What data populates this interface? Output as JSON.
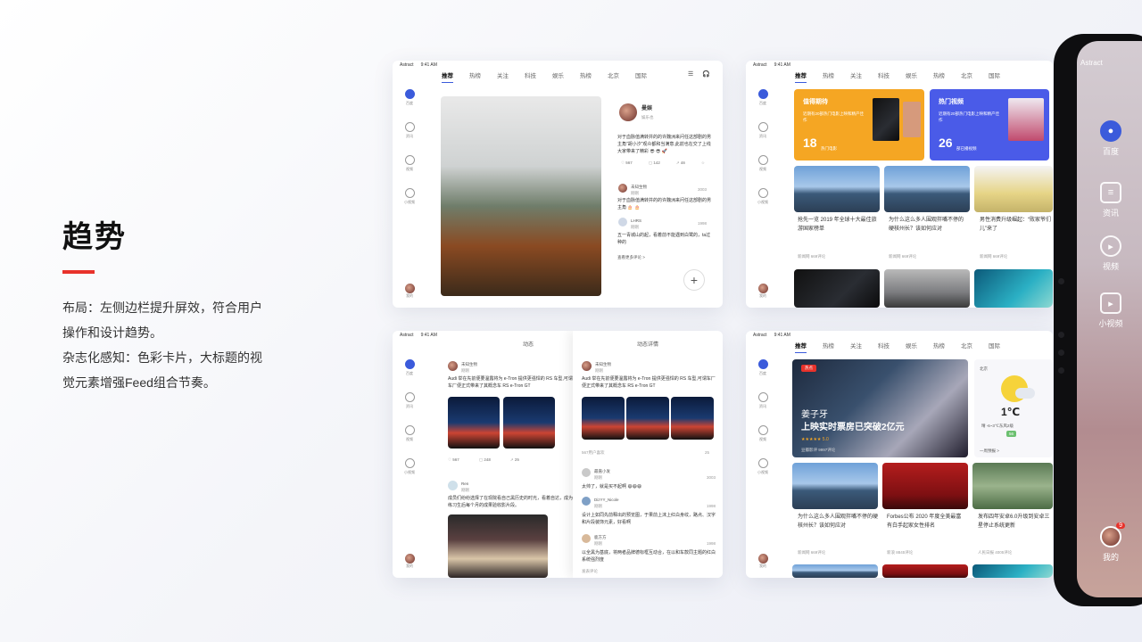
{
  "intro": {
    "title": "趋势",
    "line1": "布局：左侧边栏提升屏效，符合用户",
    "line2": "操作和设计趋势。",
    "line3": "杂志化感知：色彩卡片，大标题的视",
    "line4": "觉元素增强Feed组合节奏。"
  },
  "status": {
    "carrier": "Astract",
    "time": "9:41 AM",
    "battery": "100%"
  },
  "tabs": [
    "推荐",
    "热榜",
    "关注",
    "科技",
    "娱乐",
    "热榜",
    "北京",
    "国际"
  ],
  "sidebar": {
    "home": "百度",
    "news": "资讯",
    "video": "视频",
    "small_video": "小视频",
    "me": "我的"
  },
  "s1": {
    "user": "曼娱",
    "user_sub": "娱乐也",
    "post": "对于血脉值满转井的的许魏洲来问任这部剧的男主角“胡小汐”观众都和当满意,此前也在交了上线大家带来了精彩 😎 😎 🚀",
    "likes": "567",
    "comments": "142",
    "shares": "46",
    "c1_name": "未知生物",
    "c1_time": "刚刚",
    "c1_text": "对于血脉值满转井的的许魏洲来问任这部剧的男主角 🎂 🎂",
    "c1_count": "3003",
    "c2_name": "LHRS",
    "c2_time": "刚刚",
    "c2_text": "五一青城山的起，看着前不能遇到白鹭的，ta过种的",
    "c2_count": "1998",
    "more": "查看更多评论 >"
  },
  "s2": {
    "card1_title": "值得期待",
    "card1_desc": "近期有20部热门电影上映和精产佳作",
    "card1_num": "18",
    "card1_tag": "热门电影",
    "card1_time": "09:21",
    "card2_title": "热门视频",
    "card2_desc": "近期有20部热门电影上映和精产佳作",
    "card2_num": "26",
    "card2_tag": "部已播视频",
    "card2_time": "09:21",
    "n1": "抢先一览 2019 年全球十大最佳旅游国家榜单",
    "n1_src": "新闻网",
    "n1_cmt": "669评论",
    "n2": "为什么这么多人围观拌嘴不停的硬核州长？该如何应对",
    "n2_src": "新闻网",
    "n2_cmt": "669评论",
    "n3": "男性消费升级崛起：“败家爷们儿”来了",
    "n3_src": "新闻网",
    "n3_cmt": "669评论",
    "n3_time": "09:21"
  },
  "s3": {
    "left_title": "动态",
    "right_title": "动态详情",
    "a_name": "未知生物",
    "a_time": "刚刚",
    "a_text": "Audi 举在先前便要温露将为 e-Tron 提供更强悍的 RS 车型,可谓车厂便正式带来了其概念车 RS e-Tron GT",
    "a_likes": "567",
    "a_cmt": "248",
    "a_share": "25",
    "b_name": "Ren",
    "b_time": "刚刚",
    "b_text": "成员们纷纷选择了在现院看自己黑历史的时光，看着自达，成为练习生后每个月的成果验收影片段。",
    "d_name": "未知生物",
    "d_time": "刚刚",
    "d_text": "Audi 举在先前便要温露将为 e-Tron 提供更强悍的 RS 车型,可谓车厂便正式带来了其概念车 RS e-Tron GT",
    "d_likes": "567用户喜欢",
    "d_share": "25",
    "r1_name": "最嘉小发",
    "r1_time": "刚刚",
    "r1_text": "太帅了，就是买不起啊 😄😄😄",
    "r1_count": "3003",
    "r2_name": "DizYY_Nicole",
    "r2_time": "刚刚",
    "r2_text": "设计上如同先前释出的预览图，于果前上沫上红白身纹，路点、汉字和片段装饰元素，好看啊",
    "r2_count": "1998",
    "r3_name": "鹿方方",
    "r3_time": "刚刚",
    "r3_text": "以全黑为基底，将两者品牌德标框互动合，在以和车款同主题的红白系统强烈度",
    "r3_count": "1998",
    "more": "发表评论"
  },
  "s4": {
    "hot_tag": "热点",
    "hero_t1": "姜子牙",
    "hero_t2": "上映实时票房已突破2亿元",
    "hero_stars": "★★★★★ 5.0",
    "hero_src": "豆瓣影评",
    "hero_cmt": "9997评论",
    "weather_city": "北京",
    "weather_temp": "1℃",
    "weather_desc": "晴 -6~3℃东风2级",
    "weather_aqi": "56",
    "weather_more": "一周预报 >",
    "n1": "为什么这么多人围观拌嘴不停的硬核州长？该如何应对",
    "n1_src": "新闻网",
    "n1_cmt": "669评论",
    "n2": "Forbes公布 2020 年度全美最富有白手起家女性排名",
    "n2_src": "新浪",
    "n2_cmt": "8845评论",
    "n3": "发布四年安卓6.0升级到安卓三星停止系统更新",
    "n3_src": "人民日报",
    "n3_cmt": "4005评论"
  },
  "device": {
    "carrier": "Astract",
    "home": "百度",
    "news": "资讯",
    "video": "视频",
    "small_video": "小视频",
    "me": "我的",
    "badge": "9"
  },
  "colors": {
    "accent": "#3b5bdb",
    "red_bar": "#e8322b",
    "orange_card": "#f5a623",
    "blue_card": "#4a5be8"
  }
}
